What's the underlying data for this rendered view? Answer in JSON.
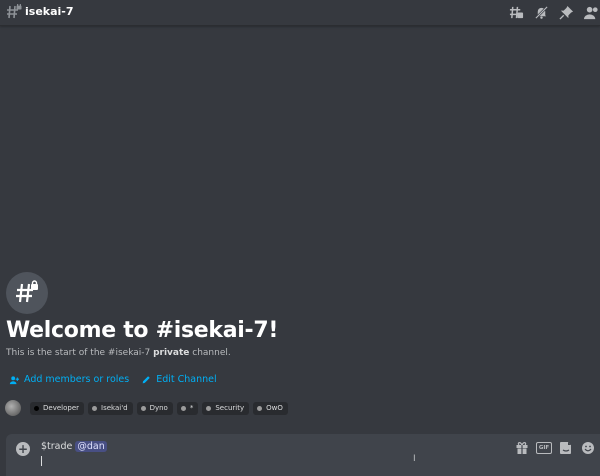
{
  "header": {
    "channel_name": "isekai-7"
  },
  "welcome": {
    "title": "Welcome to #isekai-7!",
    "desc_prefix": "This is the start of the #isekai-7 ",
    "desc_bold": "private",
    "desc_suffix": " channel."
  },
  "actions": {
    "add_members": "Add members or roles",
    "edit_channel": "Edit Channel"
  },
  "roles": [
    {
      "name": "Developer",
      "color": "#000000"
    },
    {
      "name": "Isekai'd",
      "color": "#9b9b9b"
    },
    {
      "name": "Dyno",
      "color": "#9b9b9b"
    },
    {
      "name": "*",
      "color": "#9b9b9b"
    },
    {
      "name": "Security",
      "color": "#9b9b9b"
    },
    {
      "name": "OwO",
      "color": "#9b9b9b"
    }
  ],
  "composer": {
    "command": "$trade ",
    "mention": "@dan"
  },
  "icons": {
    "top": [
      "threads-icon",
      "muted-bell-icon",
      "pin-icon",
      "member-list-icon"
    ],
    "composer": [
      "gift-icon",
      "gif-icon",
      "sticker-icon",
      "emoji-icon"
    ]
  },
  "colors": {
    "background": "#36393f",
    "link": "#00aff4",
    "composer": "#40444b"
  }
}
